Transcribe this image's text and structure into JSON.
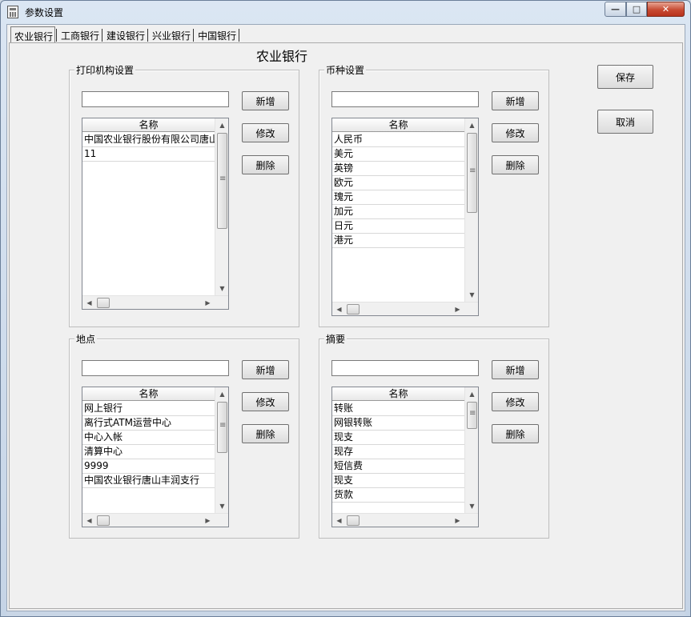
{
  "window": {
    "title": "参数设置",
    "controls": {
      "minimize": "—",
      "maximize": "□",
      "close": "✕"
    }
  },
  "tabs": [
    {
      "label": "农业银行",
      "active": true
    },
    {
      "label": "工商银行",
      "active": false
    },
    {
      "label": "建设银行",
      "active": false
    },
    {
      "label": "兴业银行",
      "active": false
    },
    {
      "label": "中国银行",
      "active": false
    }
  ],
  "page": {
    "heading": "农业银行"
  },
  "actions": {
    "save_label": "保存",
    "cancel_label": "取消"
  },
  "groups": {
    "print_org": {
      "title": "打印机构设置",
      "input_value": "",
      "column_header": "名称",
      "rows": [
        "中国农业银行股份有限公司唐山",
        "11"
      ],
      "buttons": {
        "add": "新增",
        "edit": "修改",
        "delete": "删除"
      }
    },
    "currency": {
      "title": "币种设置",
      "input_value": "",
      "column_header": "名称",
      "rows": [
        "人民币",
        "美元",
        "英镑",
        "欧元",
        "瑰元",
        "加元",
        "日元",
        "港元"
      ],
      "buttons": {
        "add": "新增",
        "edit": "修改",
        "delete": "删除"
      }
    },
    "location": {
      "title": "地点",
      "input_value": "",
      "column_header": "名称",
      "rows": [
        "网上银行",
        "离行式ATM运营中心",
        "中心入帐",
        "清算中心",
        "9999",
        "中国农业银行唐山丰润支行"
      ],
      "buttons": {
        "add": "新增",
        "edit": "修改",
        "delete": "删除"
      }
    },
    "summary": {
      "title": "摘要",
      "input_value": "",
      "column_header": "名称",
      "rows": [
        "转账",
        "网银转账",
        "现支",
        "现存",
        "短信费",
        "现支",
        "货款"
      ],
      "buttons": {
        "add": "新增",
        "edit": "修改",
        "delete": "删除"
      }
    }
  }
}
